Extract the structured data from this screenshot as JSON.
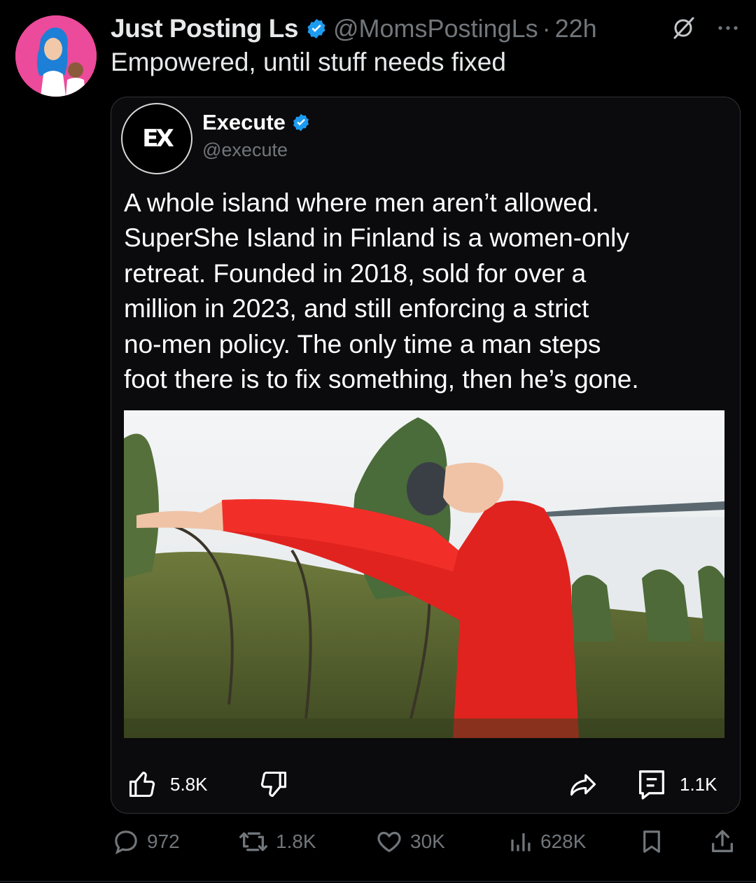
{
  "post": {
    "author_name": "Just Posting Ls",
    "author_handle": "@MomsPostingLs",
    "separator": "·",
    "time": "22h",
    "text": "Empowered, until stuff needs fixed",
    "avatar_color": "#ec4a9a"
  },
  "quoted": {
    "logo_text": "EX",
    "author_name": "Execute",
    "author_handle": "@execute",
    "body_lines": [
      "A whole island where men aren’t allowed.",
      "SuperShe Island in Finland is a women-only",
      "retreat. Founded in 2018, sold for over a",
      "million in 2023, and still enforcing a strict",
      "no-men policy. The only time a man steps",
      "foot there is to fix something, then he’s gone."
    ],
    "image_icon": "photo-woman-red-jacket-arms-outstretched",
    "likes": "5.8K",
    "comments": "1.1K"
  },
  "actions": {
    "replies": "972",
    "reposts": "1.8K",
    "likes": "30K",
    "views": "628K"
  },
  "colors": {
    "background": "#000000",
    "verified": "#1d9bf0",
    "muted": "#71767b",
    "jacket": "#e0231f"
  }
}
